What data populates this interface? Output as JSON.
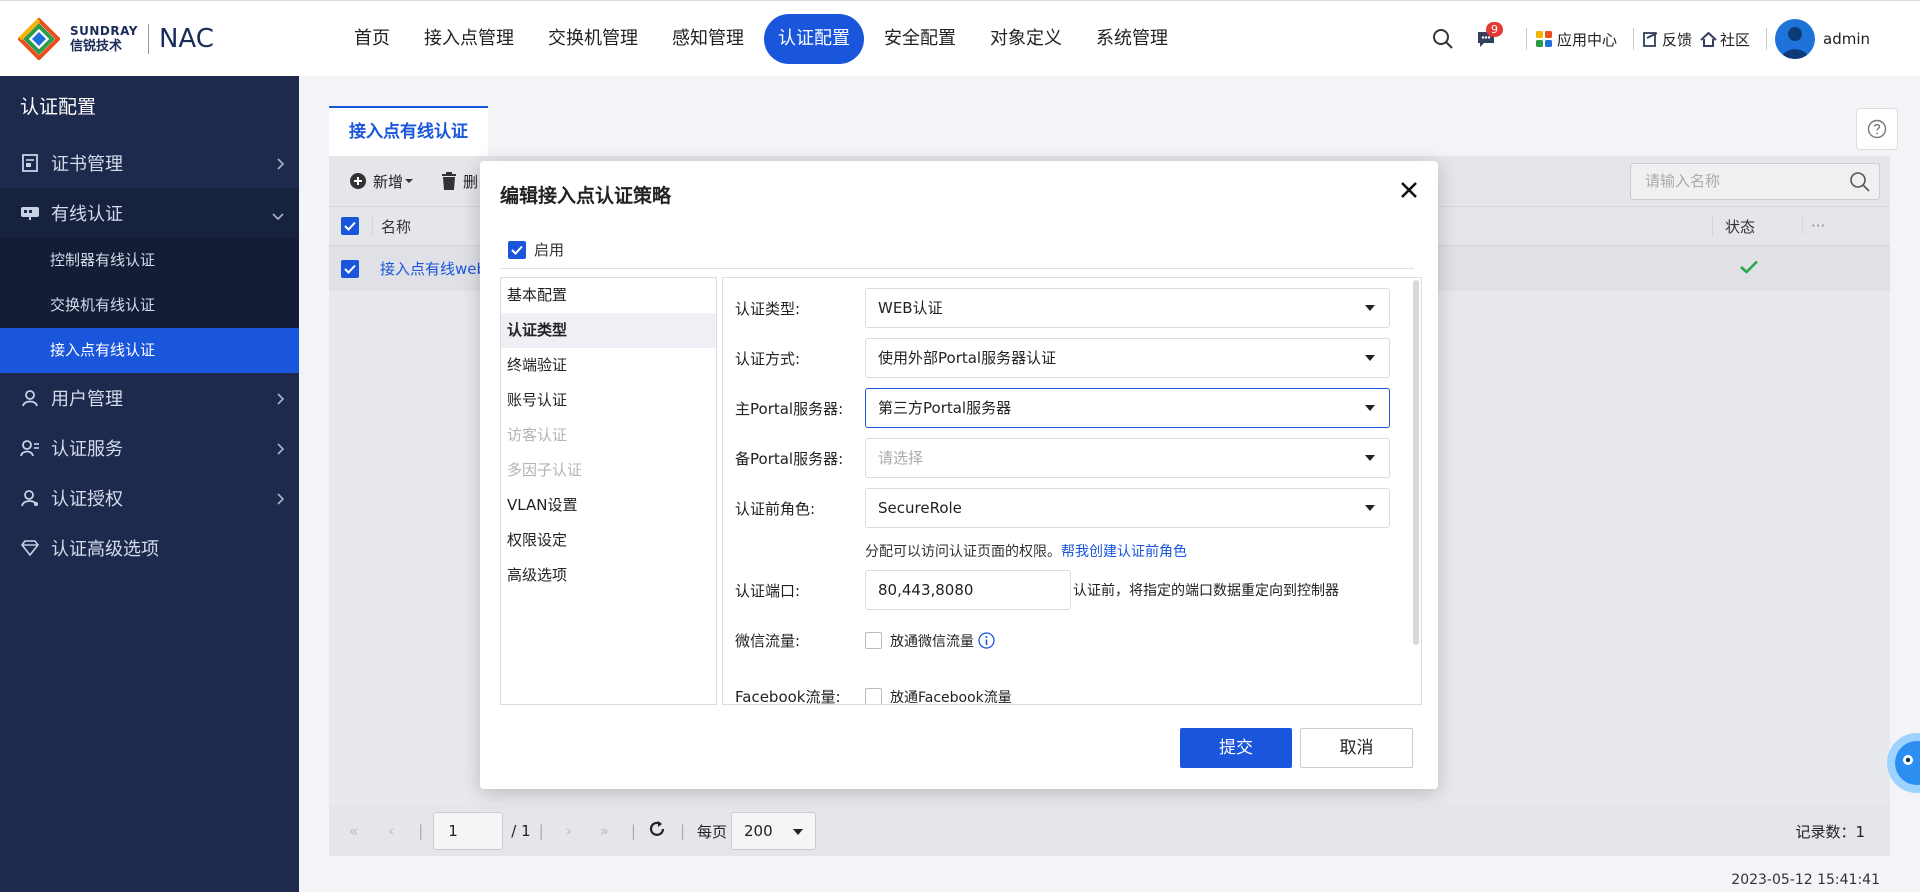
{
  "header": {
    "logo_en": "SUNDRAY",
    "logo_cn": "信锐技术",
    "product": "NAC",
    "nav": [
      "首页",
      "接入点管理",
      "交换机管理",
      "感知管理",
      "认证配置",
      "安全配置",
      "对象定义",
      "系统管理"
    ],
    "active_nav": "认证配置",
    "message_badge": "9",
    "app_center": "应用中心",
    "feedback": "反馈",
    "community": "社区",
    "user": "admin"
  },
  "sidebar": {
    "title": "认证配置",
    "items": [
      {
        "label": "证书管理",
        "icon": "certificate-icon"
      },
      {
        "label": "有线认证",
        "icon": "wired-auth-icon"
      },
      {
        "label": "用户管理",
        "icon": "user-icon"
      },
      {
        "label": "认证服务",
        "icon": "auth-service-icon"
      },
      {
        "label": "认证授权",
        "icon": "authorization-icon"
      },
      {
        "label": "认证高级选项",
        "icon": "diamond-icon"
      }
    ],
    "sub_items": [
      "控制器有线认证",
      "交换机有线认证",
      "接入点有线认证"
    ],
    "active_sub": "接入点有线认证"
  },
  "main": {
    "tab": "接入点有线认证",
    "toolbar": {
      "add": "新增",
      "delete": "删"
    },
    "search_placeholder": "请输入名称",
    "columns": {
      "name": "名称",
      "status": "状态"
    },
    "row": {
      "name": "接入点有线web"
    },
    "pager": {
      "page": "1",
      "total": "/ 1",
      "per_page_label": "每页",
      "per_page": "200",
      "records": "记录数：1"
    },
    "timestamp": "2023-05-12 15:41:41"
  },
  "modal": {
    "title": "编辑接入点认证策略",
    "enable_label": "启用",
    "menu": [
      {
        "label": "基本配置",
        "state": "normal"
      },
      {
        "label": "认证类型",
        "state": "active"
      },
      {
        "label": "终端验证",
        "state": "normal"
      },
      {
        "label": "账号认证",
        "state": "normal"
      },
      {
        "label": "访客认证",
        "state": "disabled"
      },
      {
        "label": "多因子认证",
        "state": "disabled"
      },
      {
        "label": "VLAN设置",
        "state": "normal"
      },
      {
        "label": "权限设定",
        "state": "normal"
      },
      {
        "label": "高级选项",
        "state": "normal"
      }
    ],
    "form": {
      "auth_type_label": "认证类型:",
      "auth_type_value": "WEB认证",
      "auth_method_label": "认证方式:",
      "auth_method_value": "使用外部Portal服务器认证",
      "primary_portal_label": "主Portal服务器:",
      "primary_portal_value": "第三方Portal服务器",
      "backup_portal_label": "备Portal服务器:",
      "backup_portal_placeholder": "请选择",
      "pre_auth_role_label": "认证前角色:",
      "pre_auth_role_value": "SecureRole",
      "role_hint": "分配可以访问认证页面的权限。",
      "role_hint_link": "帮我创建认证前角色",
      "auth_port_label": "认证端口:",
      "auth_port_value": "80,443,8080",
      "auth_port_hint": "认证前，将指定的端口数据重定向到控制器",
      "wechat_label": "微信流量:",
      "wechat_option": "放通微信流量",
      "facebook_label": "Facebook流量:",
      "facebook_option": "放通Facebook流量"
    },
    "submit": "提交",
    "cancel": "取消"
  },
  "colors": {
    "accent": "#1a56db",
    "sidebar_bg": "#1d2a4d",
    "success": "#2aa84a"
  }
}
